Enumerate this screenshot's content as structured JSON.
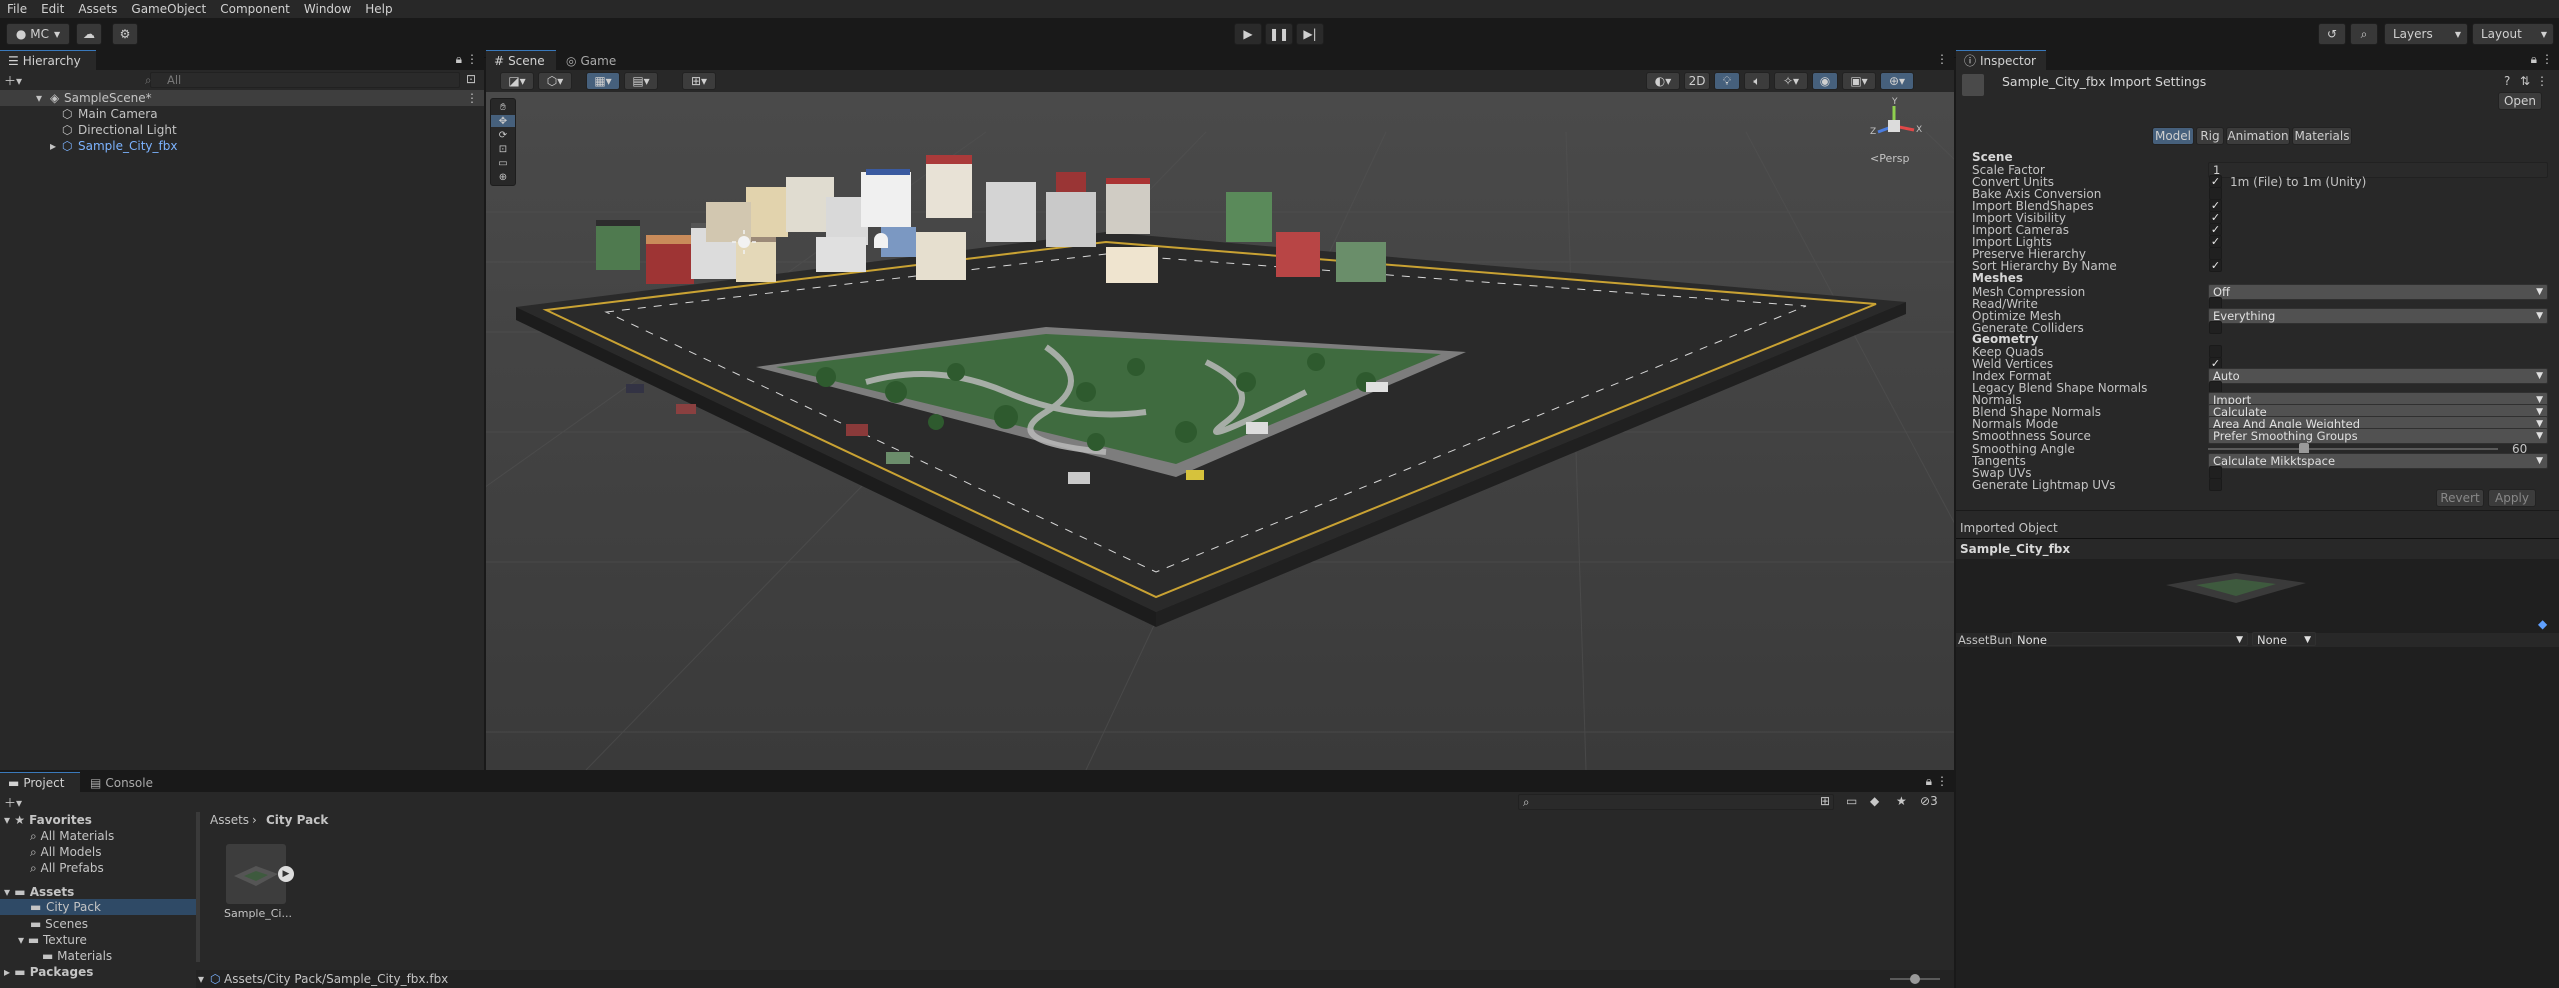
{
  "menu": [
    "File",
    "Edit",
    "Assets",
    "GameObject",
    "Component",
    "Window",
    "Help"
  ],
  "toolbar": {
    "account_label": "MC",
    "layers_label": "Layers",
    "layout_label": "Layout"
  },
  "hierarchy": {
    "tab": "Hierarchy",
    "search_placeholder": "All",
    "scene": "SampleScene*",
    "items": [
      "Main Camera",
      "Directional Light",
      "Sample_City_fbx"
    ]
  },
  "scene_view": {
    "tabs": [
      "Scene",
      "Game"
    ],
    "toggle_2d": "2D",
    "persp_label": "Persp",
    "gizmo_axes": {
      "x": "X",
      "y": "Y",
      "z": "Z"
    }
  },
  "inspector": {
    "tab": "Inspector",
    "title": "Sample_City_fbx Import Settings",
    "open_button": "Open",
    "subtabs": [
      "Model",
      "Rig",
      "Animation",
      "Materials"
    ],
    "active_subtab": "Model",
    "sections": {
      "scene": "Scene",
      "meshes": "Meshes",
      "geometry": "Geometry"
    },
    "scale_factor_label": "Scale Factor",
    "scale_factor_value": "1",
    "convert_units_label": "Convert Units",
    "convert_units_note": "1m (File) to 1m (Unity)",
    "bake_axis_label": "Bake Axis Conversion",
    "import_blendshapes_label": "Import BlendShapes",
    "import_visibility_label": "Import Visibility",
    "import_cameras_label": "Import Cameras",
    "import_lights_label": "Import Lights",
    "preserve_hierarchy_label": "Preserve Hierarchy",
    "sort_hierarchy_label": "Sort Hierarchy By Name",
    "mesh_compression_label": "Mesh Compression",
    "mesh_compression_value": "Off",
    "read_write_label": "Read/Write",
    "optimize_mesh_label": "Optimize Mesh",
    "optimize_mesh_value": "Everything",
    "generate_colliders_label": "Generate Colliders",
    "keep_quads_label": "Keep Quads",
    "weld_vertices_label": "Weld Vertices",
    "index_format_label": "Index Format",
    "index_format_value": "Auto",
    "legacy_blend_label": "Legacy Blend Shape Normals",
    "normals_label": "Normals",
    "normals_value": "Import",
    "blend_shape_normals_label": "Blend Shape Normals",
    "blend_shape_normals_value": "Calculate",
    "normals_mode_label": "Normals Mode",
    "normals_mode_value": "Area And Angle Weighted",
    "smoothness_source_label": "Smoothness Source",
    "smoothness_source_value": "Prefer Smoothing Groups",
    "smoothing_angle_label": "Smoothing Angle",
    "smoothing_angle_value": "60",
    "smoothing_angle_fraction": 0.33,
    "tangents_label": "Tangents",
    "tangents_value": "Calculate Mikktspace",
    "swap_uvs_label": "Swap UVs",
    "generate_lightmap_label": "Generate Lightmap UVs",
    "revert_button": "Revert",
    "apply_button": "Apply",
    "imported_object_label": "Imported Object",
    "preview_title": "Sample_City_fbx",
    "assetbundle_label": "AssetBundle",
    "assetbundle_value": "None",
    "assetbundle_variant": "None"
  },
  "checks": {
    "convert_units": true,
    "bake_axis": false,
    "import_blendshapes": true,
    "import_visibility": true,
    "import_cameras": true,
    "import_lights": true,
    "preserve_hierarchy": false,
    "sort_hierarchy": true,
    "read_write": false,
    "generate_colliders": false,
    "keep_quads": false,
    "weld_vertices": true,
    "legacy_blend": false,
    "swap_uvs": false,
    "generate_lightmap": false
  },
  "project": {
    "tabs": [
      "Project",
      "Console"
    ],
    "hidden_count": "3",
    "breadcrumb": [
      "Assets",
      "City Pack"
    ],
    "favorites_label": "Favorites",
    "favorites": [
      "All Materials",
      "All Models",
      "All Prefabs"
    ],
    "assets_label": "Assets",
    "tree": [
      "City Pack",
      "Scenes",
      "Texture",
      "Materials"
    ],
    "packages_label": "Packages",
    "asset_item": "Sample_Ci...",
    "status_path": "Assets/City Pack/Sample_City_fbx.fbx"
  }
}
